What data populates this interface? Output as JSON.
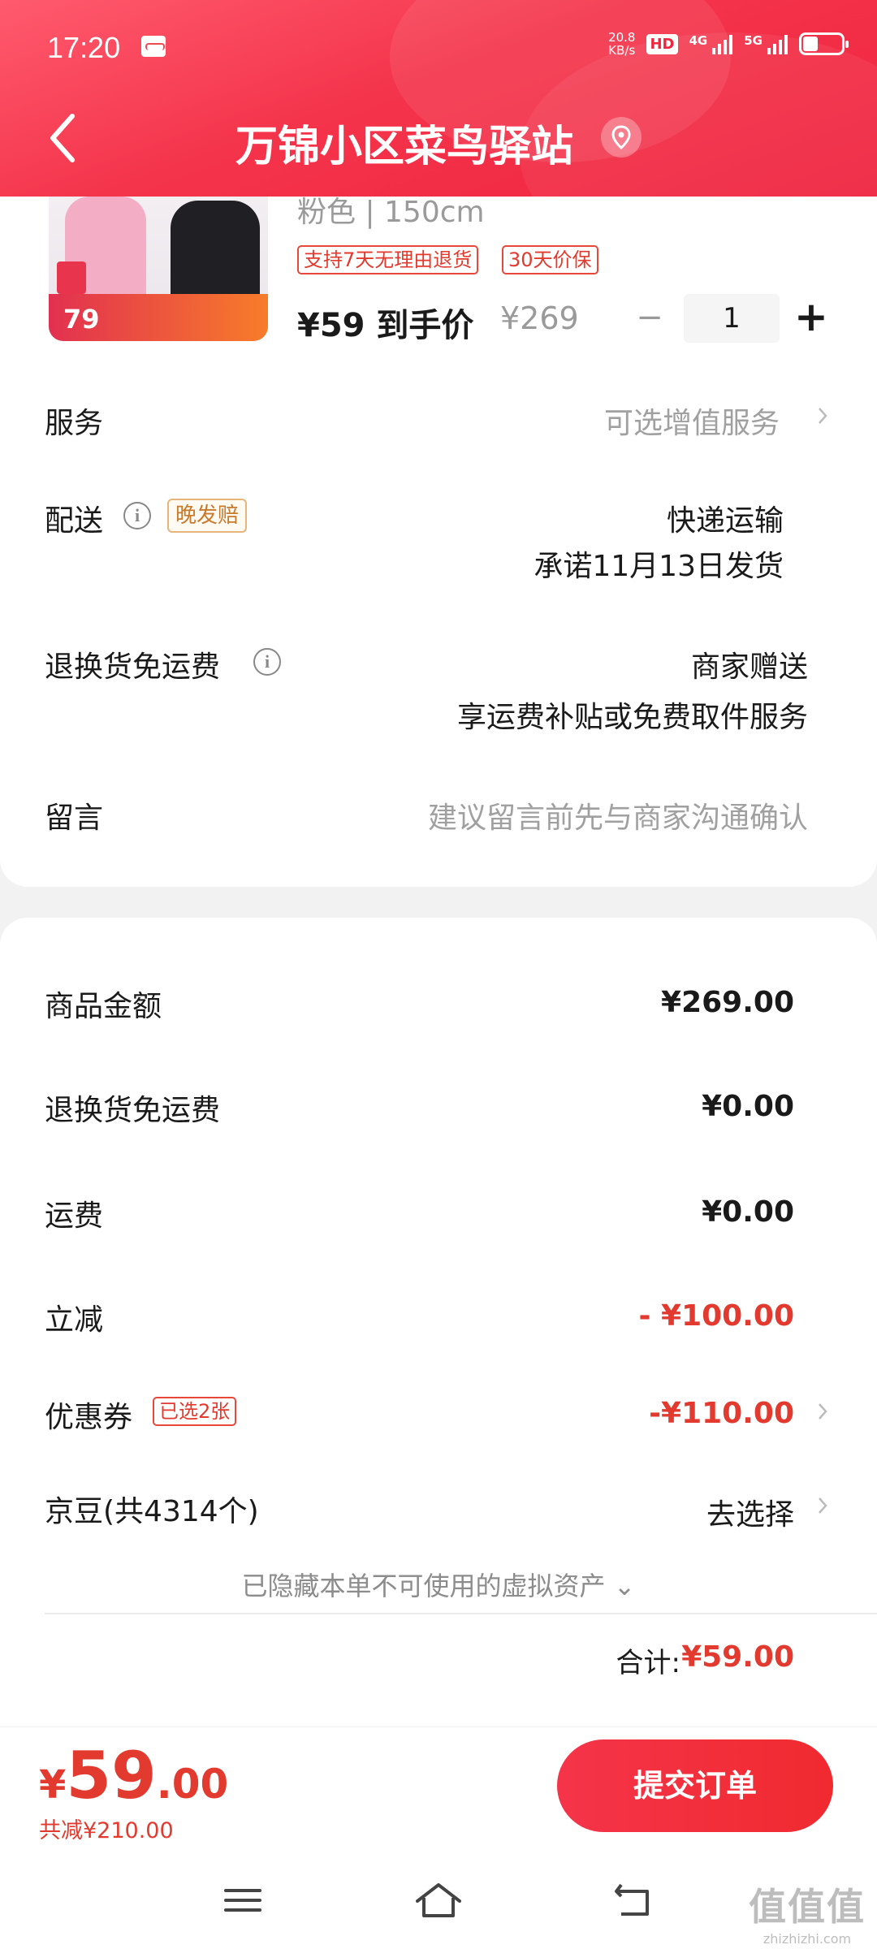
{
  "status_bar": {
    "time": "17:20",
    "net_speed_top": "20.8",
    "net_speed_unit": "KB/s",
    "hd": "HD",
    "sim1": "4G",
    "sim2": "5G"
  },
  "header": {
    "title": "万锦小区菜鸟驿站",
    "back_icon": "chevron-left-icon",
    "location_icon": "location-pin-icon"
  },
  "product": {
    "variant": "粉色 | 150cm",
    "tags": [
      "支持7天无理由退货",
      "30天价保"
    ],
    "price_now": "¥59 到手价",
    "price_orig": "¥269",
    "quantity": "1",
    "image_price": "79"
  },
  "rows": {
    "service_label": "服务",
    "service_value": "可选增值服务",
    "delivery_label": "配送",
    "delivery_tag": "晚发赔",
    "delivery_method": "快递运输",
    "delivery_promise": "承诺11月13日发货",
    "return_label": "退换货免运费",
    "return_value": "商家赠送",
    "return_desc": "享运费补贴或免费取件服务",
    "message_label": "留言",
    "message_placeholder": "建议留言前先与商家沟通确认"
  },
  "summary": {
    "goods_label": "商品金额",
    "goods_value": "¥269.00",
    "return_fee_label": "退换货免运费",
    "return_fee_value": "¥0.00",
    "shipping_label": "运费",
    "shipping_value": "¥0.00",
    "discount_label": "立减",
    "discount_value": "- ¥100.00",
    "coupon_label": "优惠券",
    "coupon_tag": "已选2张",
    "coupon_value": "-¥110.00",
    "jingdou_label": "京豆(共4314个)",
    "jingdou_value": "去选择",
    "hidden_assets": "已隐藏本单不可使用的虚拟资产 ⌄",
    "total_label": "合计:",
    "total_value": "¥59.00"
  },
  "footer": {
    "price_yen": "¥",
    "price_int": "59",
    "price_dec": ".00",
    "saved": "共减¥210.00",
    "submit": "提交订单"
  },
  "watermark": {
    "line1": "值值值",
    "line2": "zhizhizhi.com"
  },
  "colors": {
    "brand_red": "#f0243f",
    "price_red": "#e23a2e",
    "tag_orange": "#c87a2a"
  }
}
